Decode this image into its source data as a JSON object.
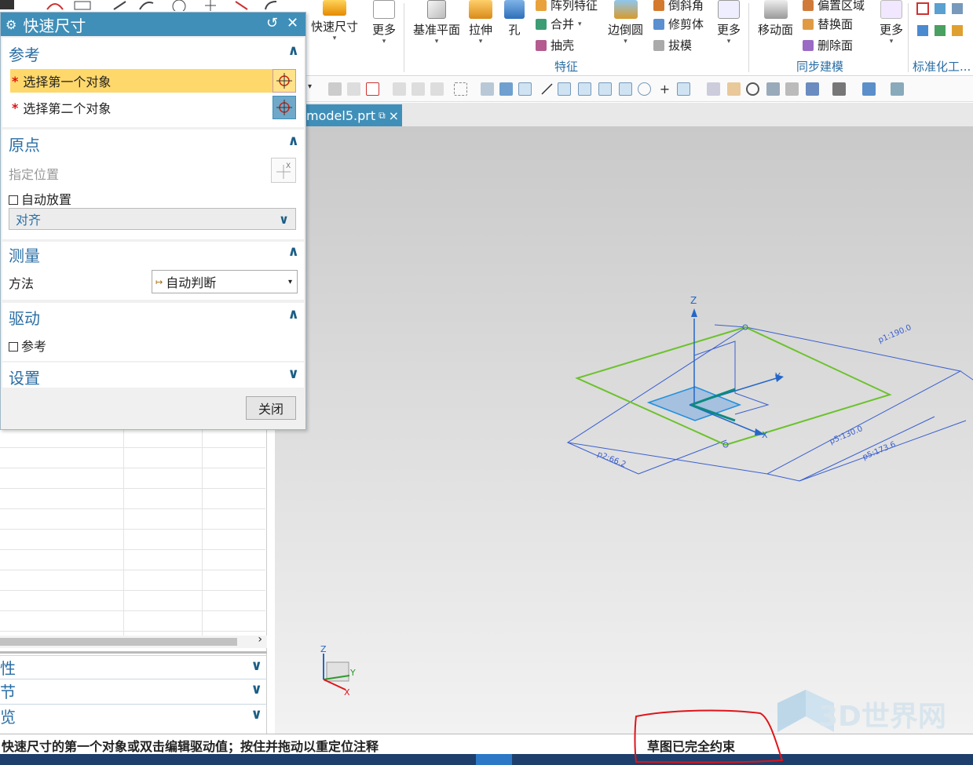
{
  "ribbon": {
    "quick_dim": "快速尺寸",
    "more1": "更多",
    "datum_plane": "基准平面",
    "extrude": "拉伸",
    "hole": "孔",
    "pattern_feature": "阵列特征",
    "unite": "合并",
    "shell": "抽壳",
    "edge_blend": "边倒圆",
    "chamfer": "倒斜角",
    "trim_body": "修剪体",
    "draft": "拔模",
    "more2": "更多",
    "group_feature": "特征",
    "move_face": "移动面",
    "offset_region": "偏置区域",
    "replace_face": "替换面",
    "delete_face": "删除面",
    "more3": "更多",
    "group_sync": "同步建模",
    "group_std": "标准化工..."
  },
  "tab": {
    "label": "model5.prt",
    "close": "×"
  },
  "dialog": {
    "title": "快速尺寸",
    "reset_icon": "↺",
    "close_icon": "✕",
    "ref_header": "参考",
    "sel_first": "选择第一个对象",
    "sel_second": "选择第二个对象",
    "origin_header": "原点",
    "specify_location": "指定位置",
    "auto_place": "自动放置",
    "align": "对齐",
    "measure_header": "测量",
    "method_label": "方法",
    "method_value": "自动判断",
    "driving_header": "驱动",
    "reference": "参考",
    "settings_header": "设置",
    "close_button": "关闭"
  },
  "navigator": {
    "sec1": "性",
    "sec2": "节",
    "sec3": "览",
    "scroll_arrow": "›"
  },
  "viewport": {
    "axis_z": "Z",
    "axis_y": "Y",
    "axis_x": "X",
    "dim_p1": "p1:190.0",
    "dim_p2": "p5:130.0",
    "dim_p3": "p5:173.6",
    "dim_p4": "p2:66.2"
  },
  "status": {
    "left": "快速尺寸的第一个对象或双击编辑驱动值；按住并拖动以重定位注释",
    "right": "草图已完全约束"
  },
  "watermark": {
    "text": "3D世界网"
  },
  "colors": {
    "accent": "#3f8fb9",
    "sketch_green": "#6cc22c",
    "dim_blue": "#3a5fcf",
    "annotation_red": "#e0141a"
  }
}
